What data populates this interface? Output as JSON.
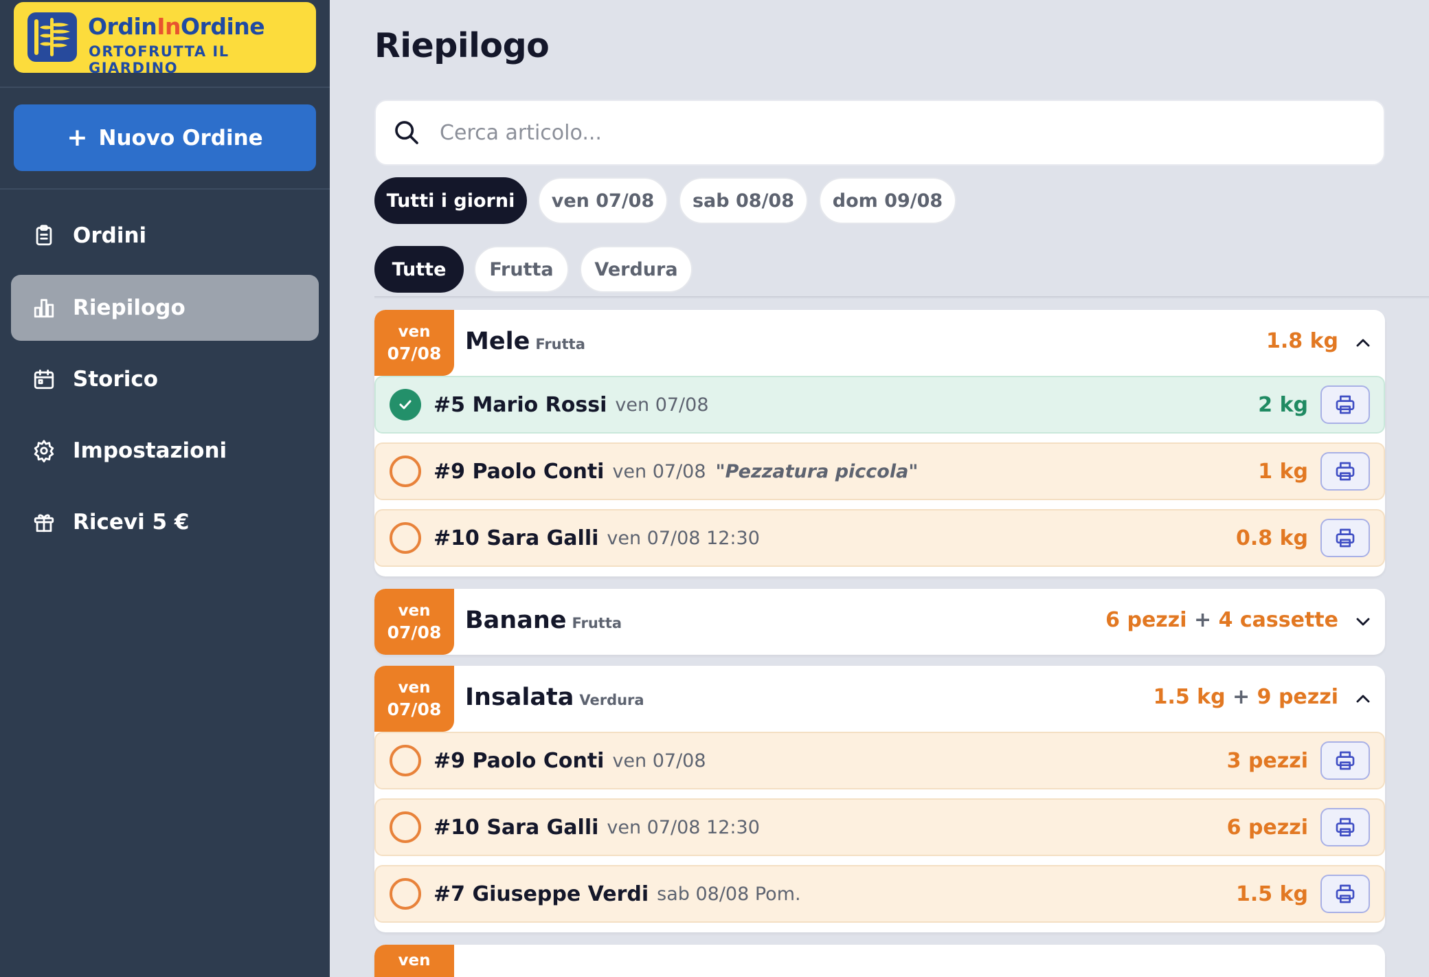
{
  "brand": {
    "title_a": "Ordin",
    "title_b": "In",
    "title_c": "Ordine",
    "subtitle": "ORTOFRUTTA IL GIARDINO"
  },
  "sidebar": {
    "new_order_label": "Nuovo Ordine",
    "items": [
      {
        "label": "Ordini",
        "icon": "clipboard-icon",
        "active": false
      },
      {
        "label": "Riepilogo",
        "icon": "chart-bars-icon",
        "active": true
      },
      {
        "label": "Storico",
        "icon": "calendar-icon",
        "active": false
      },
      {
        "label": "Impostazioni",
        "icon": "gear-icon",
        "active": false
      },
      {
        "label": "Ricevi 5 €",
        "icon": "gift-icon",
        "active": false
      }
    ]
  },
  "main": {
    "title": "Riepilogo",
    "search_placeholder": "Cerca articolo...",
    "day_filters": [
      "Tutti i giorni",
      "ven 07/08",
      "sab 08/08",
      "dom 09/08"
    ],
    "category_filters": [
      "Tutte",
      "Frutta",
      "Verdura"
    ],
    "products": [
      {
        "badge_day": "ven",
        "badge_date": "07/08",
        "name": "Mele",
        "category": "Frutta",
        "total": "1.8 kg",
        "orders": [
          {
            "status": "done",
            "name": "#5 Mario Rossi",
            "date": "ven 07/08",
            "note": "",
            "qty": "2 kg"
          },
          {
            "status": "pending",
            "name": "#9 Paolo Conti",
            "date": "ven 07/08",
            "note": "\"Pezzatura piccola\"",
            "qty": "1 kg"
          },
          {
            "status": "pending",
            "name": "#10 Sara Galli",
            "date": "ven 07/08 12:30",
            "note": "",
            "qty": "0.8 kg"
          }
        ]
      },
      {
        "badge_day": "ven",
        "badge_date": "07/08",
        "name": "Banane",
        "category": "Frutta",
        "total_a": "6 pezzi",
        "total_b": "4 cassette"
      },
      {
        "badge_day": "ven",
        "badge_date": "07/08",
        "name": "Insalata",
        "category": "Verdura",
        "total_a": "1.5 kg",
        "total_b": "9 pezzi",
        "orders": [
          {
            "status": "pending",
            "name": "#9 Paolo Conti",
            "date": "ven 07/08",
            "note": "",
            "qty": "3 pezzi"
          },
          {
            "status": "pending",
            "name": "#10 Sara Galli",
            "date": "ven 07/08 12:30",
            "note": "",
            "qty": "6 pezzi"
          },
          {
            "status": "pending",
            "name": "#7 Giuseppe Verdi",
            "date": "sab 08/08 Pom.",
            "note": "",
            "qty": "1.5 kg"
          }
        ]
      },
      {
        "badge_day": "ven"
      }
    ]
  }
}
